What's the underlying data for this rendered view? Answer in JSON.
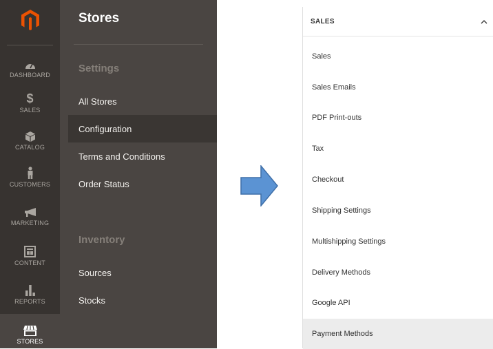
{
  "nav": {
    "items": [
      {
        "label": "DASHBOARD",
        "icon": "dashboard-icon"
      },
      {
        "label": "SALES",
        "icon": "dollar-icon"
      },
      {
        "label": "CATALOG",
        "icon": "cube-icon"
      },
      {
        "label": "CUSTOMERS",
        "icon": "person-icon"
      },
      {
        "label": "MARKETING",
        "icon": "megaphone-icon"
      },
      {
        "label": "CONTENT",
        "icon": "layout-icon"
      },
      {
        "label": "REPORTS",
        "icon": "bar-chart-icon"
      },
      {
        "label": "STORES",
        "icon": "storefront-icon"
      }
    ],
    "active_item": "STORES"
  },
  "panel": {
    "title": "Stores",
    "sections": [
      {
        "title": "Settings",
        "links": [
          "All Stores",
          "Configuration",
          "Terms and Conditions",
          "Order Status"
        ]
      },
      {
        "title": "Inventory",
        "links": [
          "Sources",
          "Stocks"
        ]
      }
    ],
    "active_link": "Configuration"
  },
  "config": {
    "header": "SALES",
    "items": [
      "Sales",
      "Sales Emails",
      "PDF Print-outs",
      "Tax",
      "Checkout",
      "Shipping Settings",
      "Multishipping Settings",
      "Delivery Methods",
      "Google API",
      "Payment Methods"
    ],
    "active_item": "Payment Methods"
  },
  "colors": {
    "nav_bg": "#373330",
    "panel_bg": "#4a4542",
    "logo_orange": "#eb5202",
    "arrow_blue": "#5b93d3"
  }
}
